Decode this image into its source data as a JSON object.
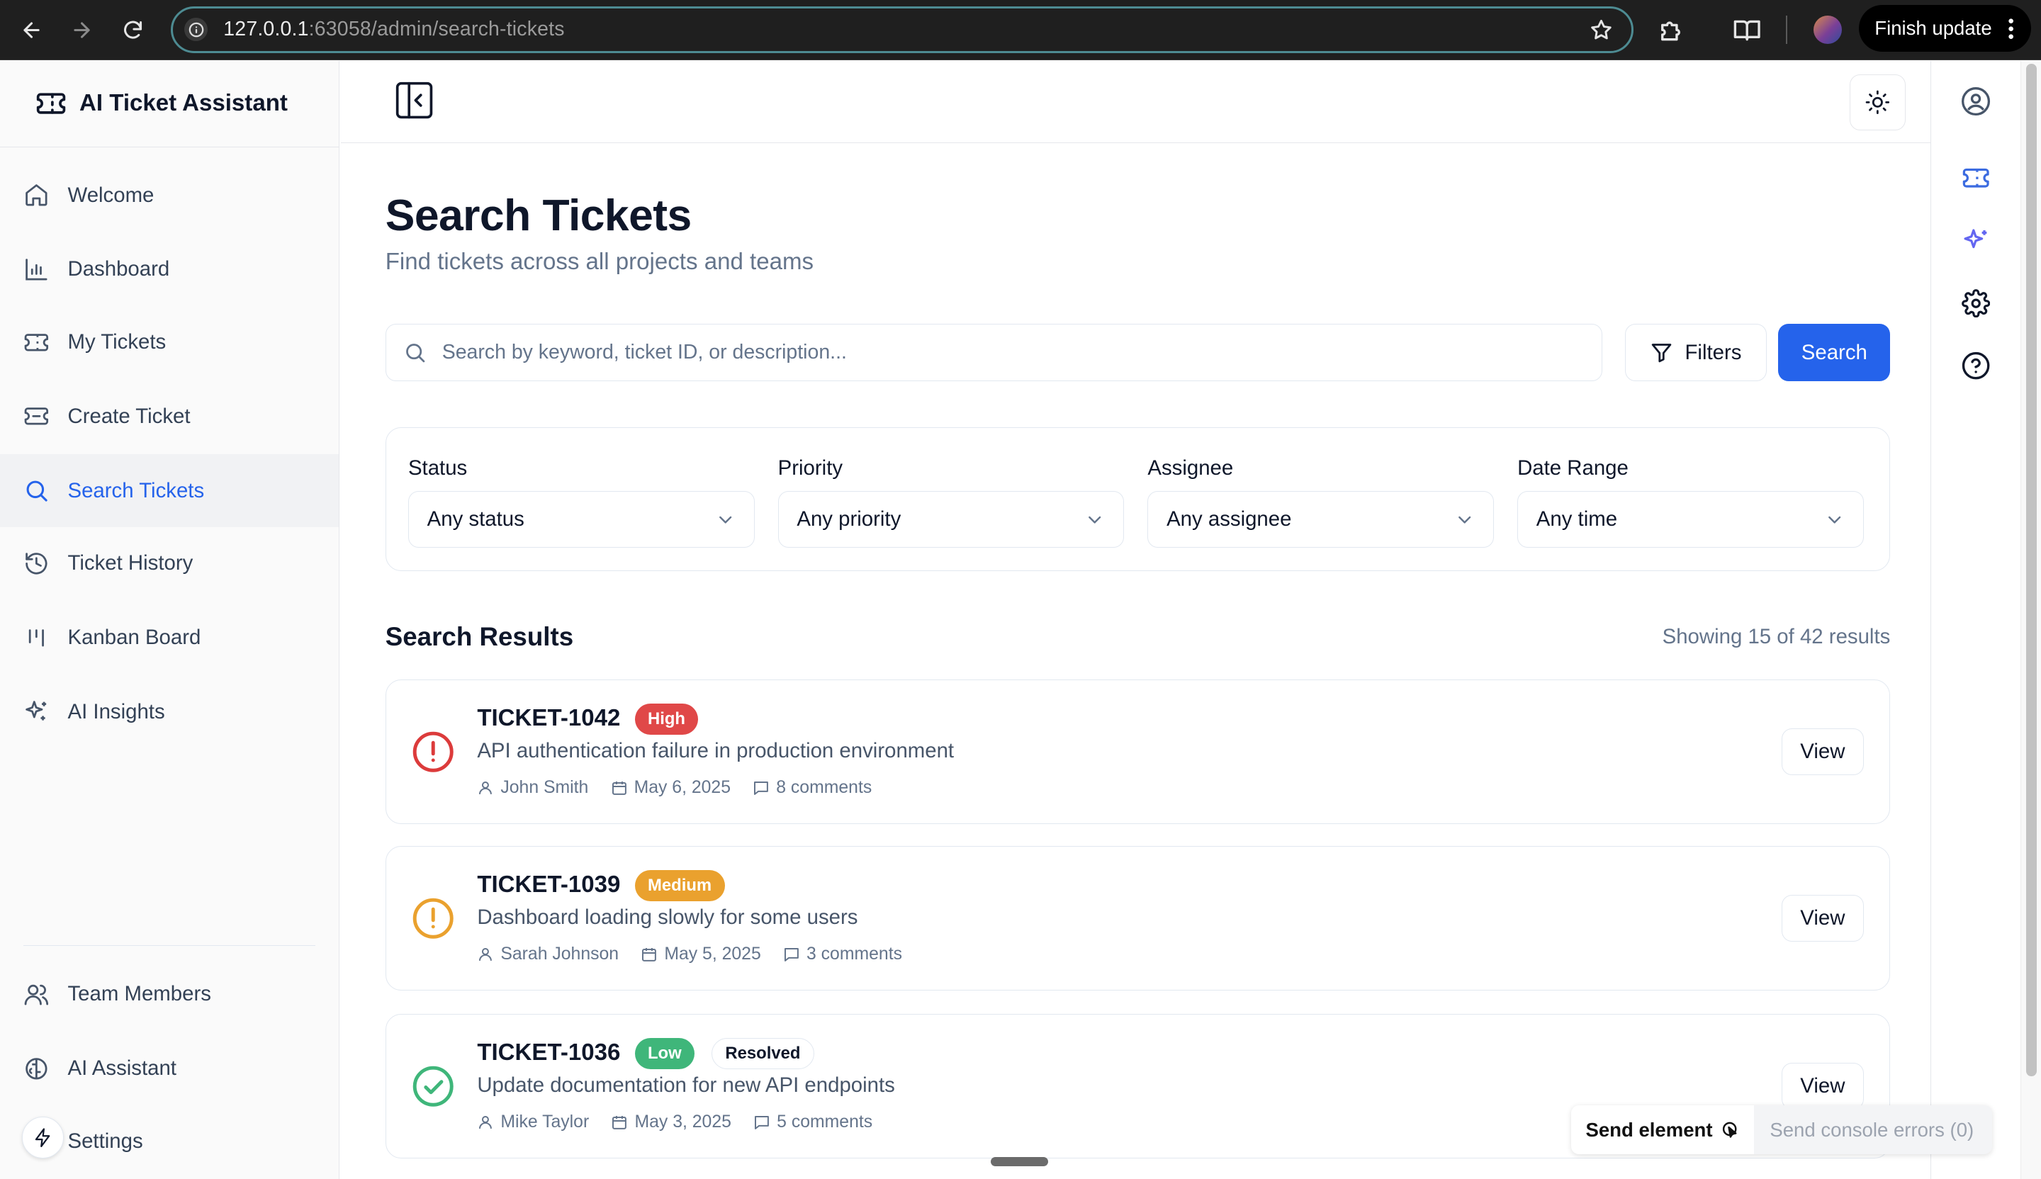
{
  "browser": {
    "url_host": "127.0.0.1",
    "url_rest": ":63058/admin/search-tickets",
    "finish_update_label": "Finish update"
  },
  "sidebar": {
    "brand": "AI Ticket Assistant",
    "items": [
      {
        "label": "Welcome",
        "icon": "home-icon"
      },
      {
        "label": "Dashboard",
        "icon": "bar-chart-icon"
      },
      {
        "label": "My Tickets",
        "icon": "ticket-icon"
      },
      {
        "label": "Create Ticket",
        "icon": "ticket-plus-icon"
      },
      {
        "label": "Search Tickets",
        "icon": "search-icon",
        "active": true
      },
      {
        "label": "Ticket History",
        "icon": "history-icon"
      },
      {
        "label": "Kanban Board",
        "icon": "kanban-icon"
      },
      {
        "label": "AI Insights",
        "icon": "sparkles-icon"
      }
    ],
    "bottom_items": [
      {
        "label": "Team Members",
        "icon": "users-icon"
      },
      {
        "label": "AI Assistant",
        "icon": "brain-icon"
      },
      {
        "label": "Settings",
        "icon": "settings-icon"
      }
    ]
  },
  "page": {
    "title": "Search Tickets",
    "subtitle": "Find tickets across all projects and teams"
  },
  "search": {
    "placeholder": "Search by keyword, ticket ID, or description...",
    "value": "",
    "filters_label": "Filters",
    "search_label": "Search"
  },
  "filters": {
    "status": {
      "label": "Status",
      "value": "Any status"
    },
    "priority": {
      "label": "Priority",
      "value": "Any priority"
    },
    "assignee": {
      "label": "Assignee",
      "value": "Any assignee"
    },
    "date_range": {
      "label": "Date Range",
      "value": "Any time"
    }
  },
  "results": {
    "title": "Search Results",
    "count_text": "Showing 15 of 42 results",
    "tickets": [
      {
        "id": "TICKET-1042",
        "priority": "High",
        "priority_color": "#e04848",
        "status_icon": "alert-circle-icon",
        "status_color": "#dc3b3b",
        "description": "API authentication failure in production environment",
        "assignee": "John Smith",
        "date": "May 6, 2025",
        "comments": "8 comments",
        "view_label": "View"
      },
      {
        "id": "TICKET-1039",
        "priority": "Medium",
        "priority_color": "#eaa12e",
        "status_icon": "alert-circle-icon",
        "status_color": "#eaa12e",
        "description": "Dashboard loading slowly for some users",
        "assignee": "Sarah Johnson",
        "date": "May 5, 2025",
        "comments": "3 comments",
        "view_label": "View"
      },
      {
        "id": "TICKET-1036",
        "priority": "Low",
        "priority_color": "#3fb67a",
        "status_badge": "Resolved",
        "status_icon": "check-circle-icon",
        "status_color": "#3fb67a",
        "description": "Update documentation for new API endpoints",
        "assignee": "Mike Taylor",
        "date": "May 3, 2025",
        "comments": "5 comments",
        "view_label": "View"
      }
    ]
  },
  "devtools": {
    "send_element": "Send element",
    "send_console_errors": "Send console errors (0)"
  },
  "colors": {
    "accent": "#2563eb",
    "active_bg": "#f1f2f4"
  }
}
